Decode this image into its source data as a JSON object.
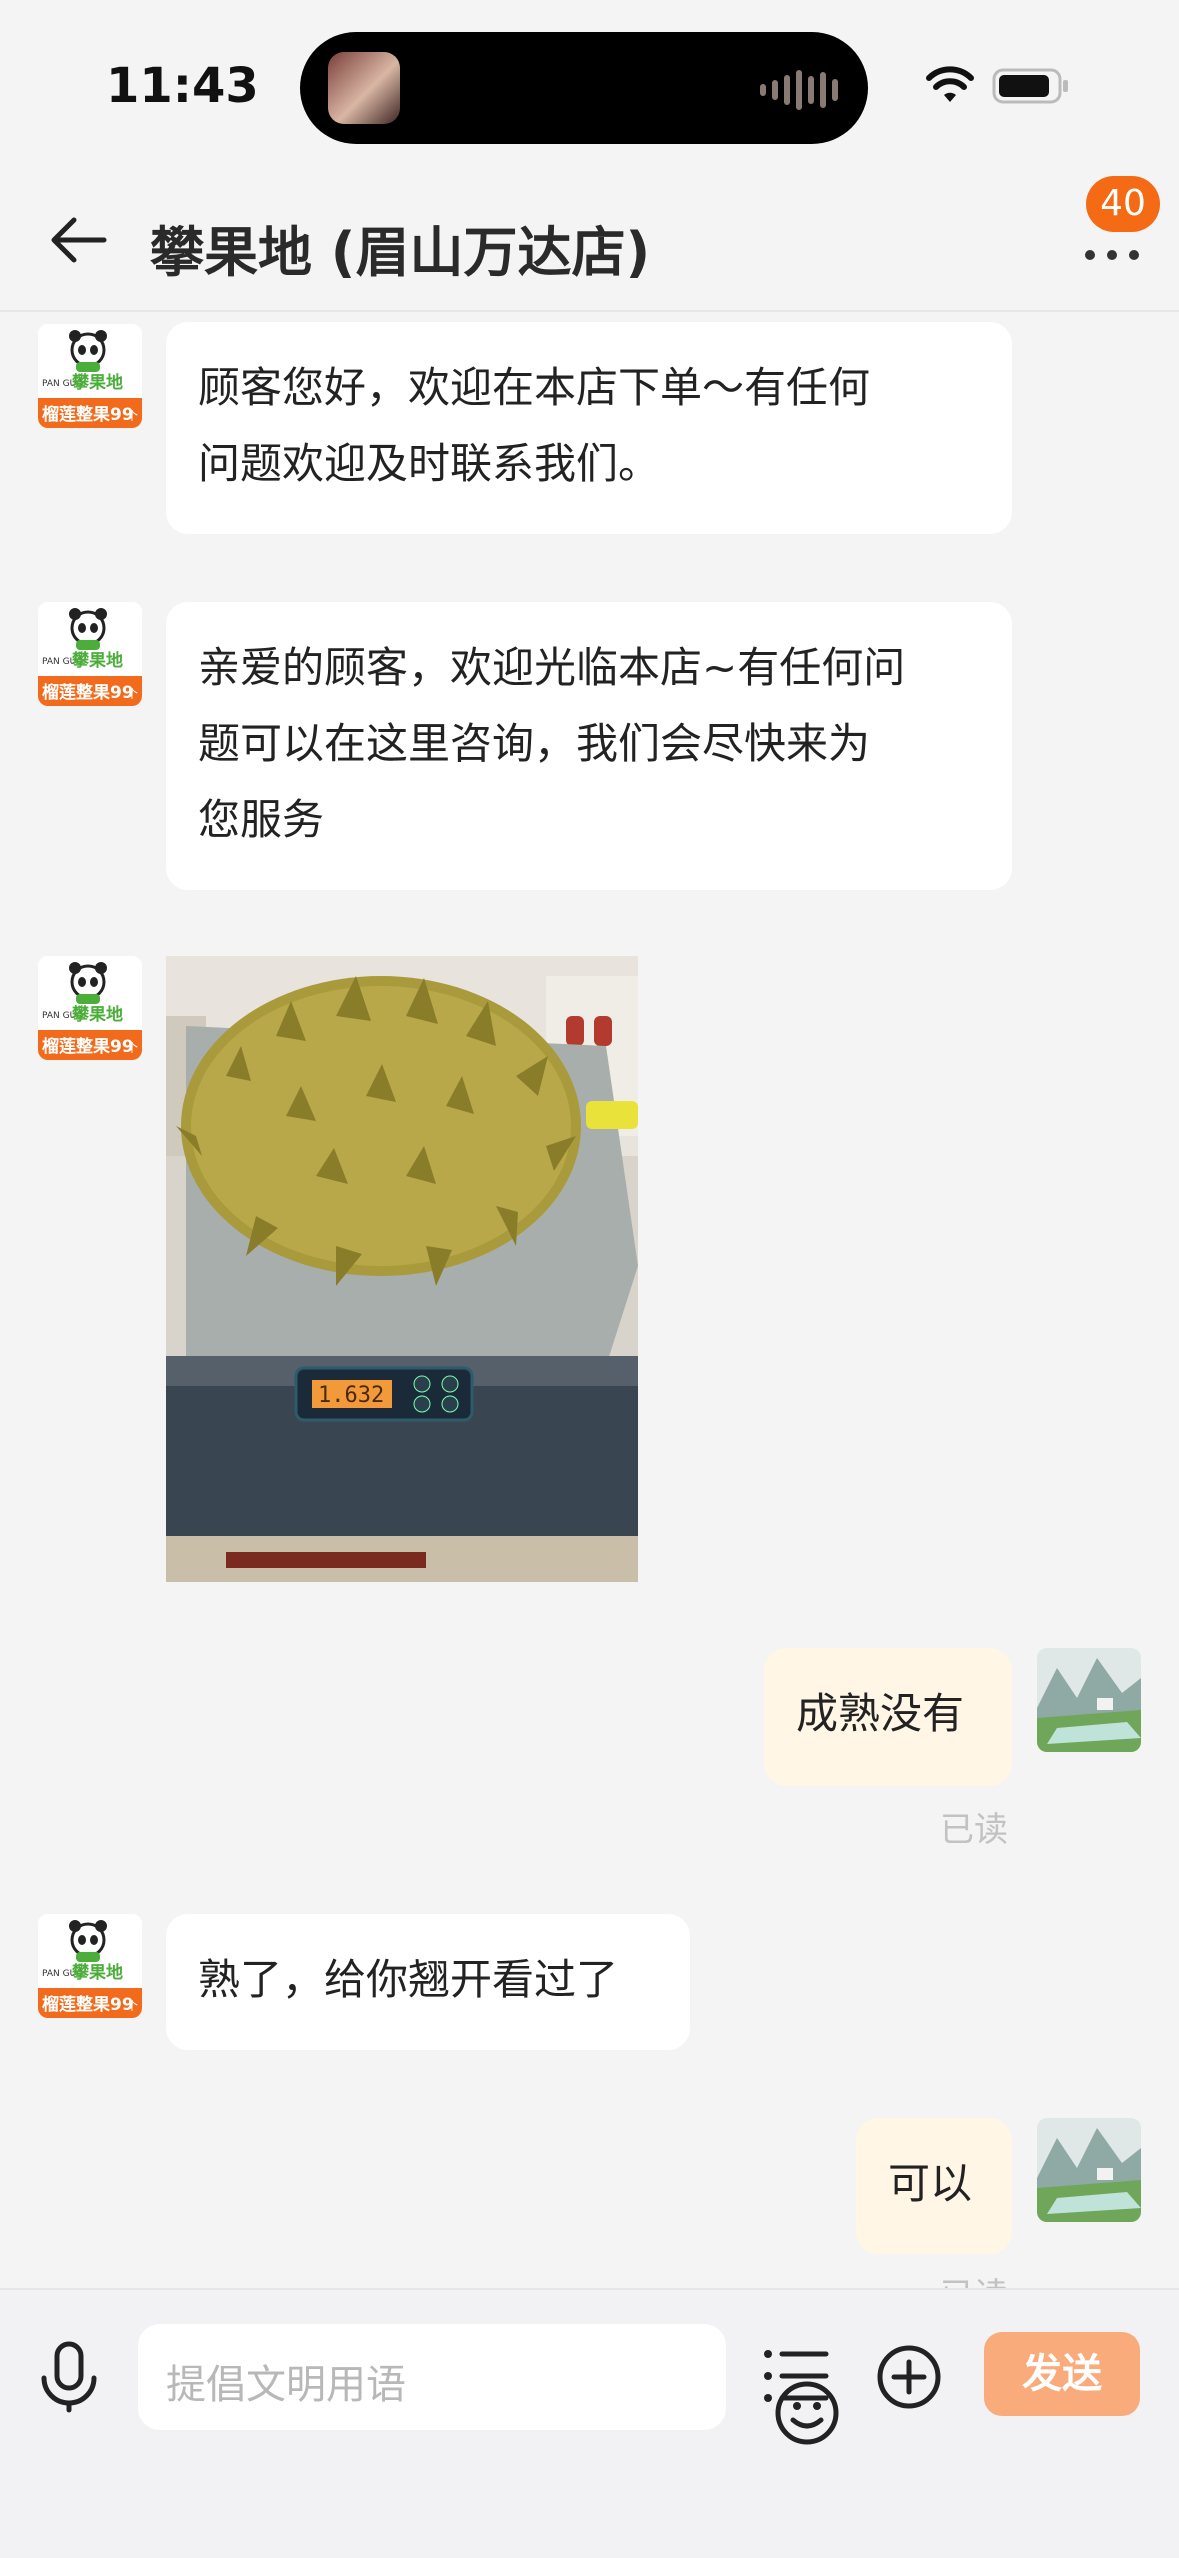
{
  "status": {
    "time": "11:43"
  },
  "header": {
    "title": "攀果地 (眉山万达店)",
    "badge_count": "40"
  },
  "shop_avatar": {
    "brand_small": "PAN GUO",
    "brand_name": "攀果地",
    "promo": "榴莲整果99",
    "promo_unit": "个"
  },
  "messages": [
    {
      "side": "in",
      "type": "text",
      "text_line1": "顾客您好，欢迎在本店下单～有任何",
      "text_line2": "问题欢迎及时联系我们。"
    },
    {
      "side": "in",
      "type": "text",
      "text_line1": "亲爱的顾客，欢迎光临本店~有任何问",
      "text_line2": "题可以在这里咨询，我们会尽快来为",
      "text_line3": "您服务"
    },
    {
      "side": "in",
      "type": "image",
      "scale_reading": "1.632"
    },
    {
      "side": "out",
      "type": "text",
      "text": "成熟没有",
      "status": "已读"
    },
    {
      "side": "in",
      "type": "text",
      "text": "熟了，给你翘开看过了"
    },
    {
      "side": "out",
      "type": "text",
      "text": "可以",
      "status": "已读"
    }
  ],
  "input": {
    "placeholder": "提倡文明用语",
    "send_label": "发送"
  },
  "icons": {
    "back": "arrow-left-icon",
    "more": "more-dots-icon",
    "mic": "microphone-icon",
    "emoji": "emoji-icon",
    "list": "list-icon",
    "plus": "plus-icon"
  },
  "colors": {
    "accent": "#f56a14",
    "send_button": "#f9ab7c",
    "outgoing_bubble": "#fff6e6"
  }
}
